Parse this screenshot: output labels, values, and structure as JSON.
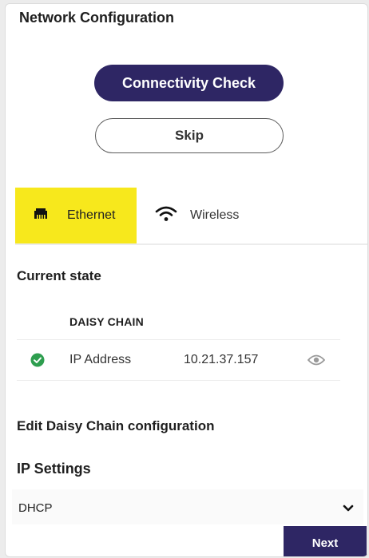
{
  "header": {
    "title": "Network Configuration"
  },
  "actions": {
    "connectivity_check_label": "Connectivity Check",
    "skip_label": "Skip"
  },
  "tabs": [
    {
      "label": "Ethernet",
      "icon": "ethernet-icon",
      "active": true
    },
    {
      "label": "Wireless",
      "icon": "wifi-icon",
      "active": false
    }
  ],
  "current_state": {
    "heading": "Current state",
    "chain_title": "DAISY CHAIN",
    "rows": [
      {
        "label": "IP Address",
        "value": "10.21.37.157",
        "status_icon": "check-circle-icon",
        "action_icon": "eye-icon"
      }
    ]
  },
  "edit": {
    "heading": "Edit Daisy Chain configuration",
    "ip_settings_label": "IP Settings",
    "ip_mode_selected": "DHCP"
  },
  "footer": {
    "next_label": "Next"
  },
  "colors": {
    "primary": "#2e2664",
    "active_tab": "#f7e81c",
    "success": "#2e9e4f"
  }
}
